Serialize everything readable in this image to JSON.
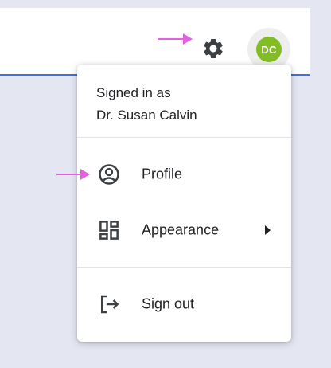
{
  "header": {
    "settings_icon": "gear-icon",
    "avatar": {
      "initials": "DC",
      "color": "#82bd24"
    },
    "accent_color": "#3f6ee0"
  },
  "annotations": {
    "arrow_color": "#e65fe0"
  },
  "menu": {
    "signed_in_label": "Signed in as",
    "user_name": "Dr. Susan Calvin",
    "items": [
      {
        "label": "Profile",
        "icon": "account-circle-icon"
      },
      {
        "label": "Appearance",
        "icon": "dashboard-icon",
        "has_submenu": true
      },
      {
        "label": "Sign out",
        "icon": "logout-icon"
      }
    ]
  }
}
